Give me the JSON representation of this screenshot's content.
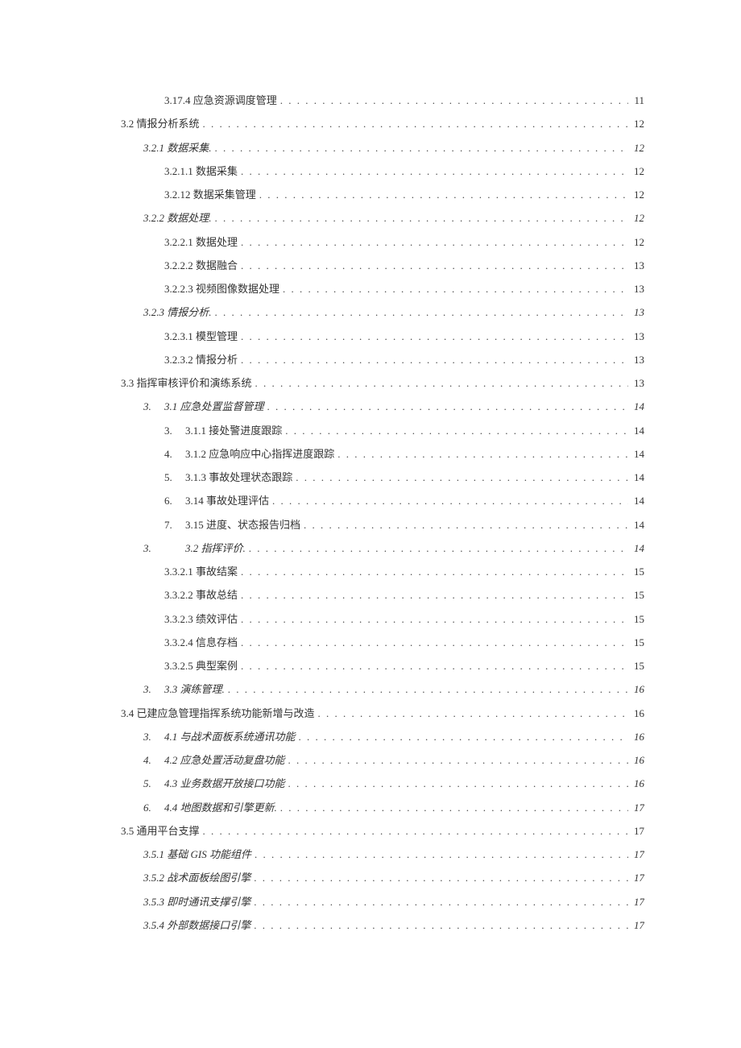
{
  "toc": [
    {
      "cls": "lvl-4",
      "label": "3.17.4 应急资源调度管理",
      "page": "11"
    },
    {
      "cls": "lvl-2",
      "label": "3.2 情报分析系统",
      "page": "12"
    },
    {
      "cls": "lvl-3 italic",
      "label": "3.2.1 数据采集.",
      "page": "12"
    },
    {
      "cls": "lvl-4",
      "label": "3.2.1.1 数据采集",
      "page": "12"
    },
    {
      "cls": "lvl-4",
      "label": "3.2.12 数据采集管理",
      "page": "12"
    },
    {
      "cls": "lvl-3 italic",
      "label": "3.2.2 数据处理.",
      "page": "12"
    },
    {
      "cls": "lvl-4",
      "label": "3.2.2.1 数据处理",
      "page": "12"
    },
    {
      "cls": "lvl-4",
      "label": "3.2.2.2 数据融合",
      "page": "13"
    },
    {
      "cls": "lvl-4",
      "label": "3.2.2.3 视频图像数据处理",
      "page": "13"
    },
    {
      "cls": "lvl-3 italic",
      "label": "3.2.3 情报分析.",
      "page": "13"
    },
    {
      "cls": "lvl-4",
      "label": "3.2.3.1 模型管理",
      "page": "13"
    },
    {
      "cls": "lvl-4",
      "label": "3.2.3.2 情报分析",
      "page": "13"
    },
    {
      "cls": "lvl-2",
      "label": "3.3 指挥审核评价和演练系统",
      "page": "13"
    },
    {
      "cls": "lvl-4m italic",
      "num": "3.",
      "label": "3.1 应急处置监督管理",
      "page": "14"
    },
    {
      "cls": "lvl-4n",
      "num": "3.",
      "label": "3.1.1 接处警进度跟踪",
      "page": "14"
    },
    {
      "cls": "lvl-4n",
      "num": "4.",
      "label": "3.1.2 应急响应中心指挥进度跟踪",
      "page": "14"
    },
    {
      "cls": "lvl-4n",
      "num": "5.",
      "label": "3.1.3 事故处理状态跟踪",
      "page": "14"
    },
    {
      "cls": "lvl-4n",
      "num": "6.",
      "label": "3.14 事故处理评估",
      "page": "14"
    },
    {
      "cls": "lvl-4n",
      "num": "7.",
      "label": "3.15 进度、状态报告归档",
      "page": "14"
    },
    {
      "cls": "lvl-4m italic",
      "num": "3.",
      "label": "3.2 指挥评价.",
      "gap": true,
      "page": "14"
    },
    {
      "cls": "lvl-4",
      "label": "3.3.2.1 事故结案",
      "page": "15"
    },
    {
      "cls": "lvl-4",
      "label": "3.3.2.2 事故总结",
      "page": "15"
    },
    {
      "cls": "lvl-4",
      "label": "3.3.2.3 绩效评估",
      "page": "15"
    },
    {
      "cls": "lvl-4",
      "label": "3.3.2.4 信息存档",
      "page": "15"
    },
    {
      "cls": "lvl-4",
      "label": "3.3.2.5 典型案例",
      "page": "15"
    },
    {
      "cls": "lvl-4m italic",
      "num": "3.",
      "label": "3.3 演练管理.",
      "page": "16"
    },
    {
      "cls": "lvl-2",
      "label": "3.4 已建应急管理指挥系统功能新增与改造",
      "page": "16"
    },
    {
      "cls": "lvl-4m italic",
      "num": "3.",
      "label": "4.1 与战术面板系统通讯功能",
      "page": "16"
    },
    {
      "cls": "lvl-4m italic",
      "num": "4.",
      "label": "4.2 应急处置活动复盘功能",
      "page": "16"
    },
    {
      "cls": "lvl-4m italic",
      "num": "5.",
      "label": "4.3 业务数据开放接口功能",
      "page": "16"
    },
    {
      "cls": "lvl-4m italic",
      "num": "6.",
      "label": "4.4 地图数据和引擎更新.",
      "page": "17"
    },
    {
      "cls": "lvl-2",
      "label": "3.5 通用平台支撑",
      "page": "17"
    },
    {
      "cls": "lvl-3 italic",
      "label": "3.5.1 基础 GIS 功能组件",
      "page": "17"
    },
    {
      "cls": "lvl-3 italic",
      "label": "3.5.2 战术面板绘图引擎",
      "page": "17"
    },
    {
      "cls": "lvl-3 italic",
      "label": "3.5.3 即时通讯支撑引擎",
      "page": "17"
    },
    {
      "cls": "lvl-3 italic",
      "label": "3.5.4 外部数据接口引擎",
      "page": "17"
    }
  ]
}
